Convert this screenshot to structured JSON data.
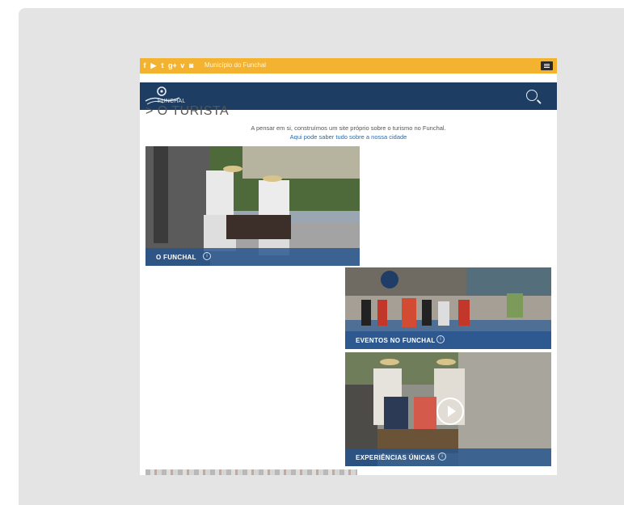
{
  "topbar": {
    "social_icons": [
      "facebook-icon",
      "youtube-icon",
      "twitter-icon",
      "google-plus-icon",
      "vimeo-icon",
      "instagram-icon"
    ],
    "municipality_link": "Município do Funchal"
  },
  "navbar": {
    "logo_text": "FUNCHAL"
  },
  "page_title": "> O TURISTA",
  "intro": {
    "text": "A pensar em si, construímos um site próprio sobre o turismo no Funchal.",
    "link": "Aqui pode saber tudo sobre a nossa cidade"
  },
  "tiles": [
    {
      "label": "O FUNCHAL"
    },
    {
      "label": "EVENTOS NO FUNCHAL"
    },
    {
      "label": "EXPERIÊNCIAS ÚNICAS"
    }
  ],
  "colors": {
    "topbar": "#f3b330",
    "navbar": "#1d3d63",
    "caption": "#26548f",
    "link": "#2b6aa8"
  }
}
